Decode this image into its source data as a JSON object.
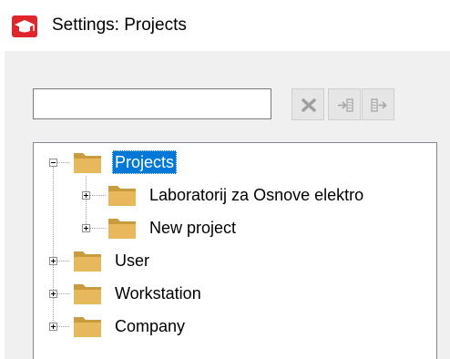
{
  "window": {
    "title": "Settings: Projects"
  },
  "search": {
    "value": "",
    "placeholder": ""
  },
  "toolbar": {
    "buttons": [
      {
        "icon": "clear-x-icon",
        "enabled": false
      },
      {
        "icon": "import-icon",
        "enabled": false
      },
      {
        "icon": "export-icon",
        "enabled": false
      }
    ]
  },
  "tree": {
    "projects": {
      "label": "Projects",
      "selected": true,
      "expanded": true
    },
    "lab_project": {
      "label": "Laboratorij za Osnove elektro",
      "expanded": false
    },
    "new_project": {
      "label": "New project",
      "expanded": false
    },
    "user": {
      "label": "User",
      "expanded": false
    },
    "workstation": {
      "label": "Workstation",
      "expanded": false
    },
    "company": {
      "label": "Company",
      "expanded": false
    }
  },
  "colors": {
    "selection": "#0078d7",
    "folder": "#e8b85c",
    "app_icon": "#e0262a",
    "panel_background": "#f0f0f0"
  }
}
